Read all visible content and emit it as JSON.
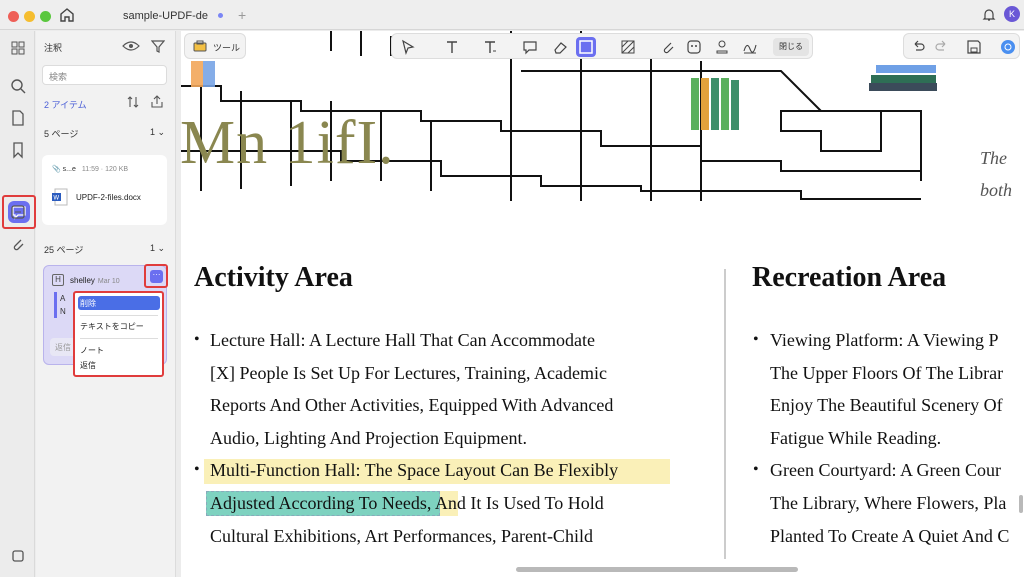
{
  "window": {
    "tab_title": "sample-UPDF-de",
    "avatar_initial": "K"
  },
  "panel": {
    "title": "注釈",
    "search_placeholder": "検索",
    "item_count": "2 アイテム",
    "groups": [
      {
        "page_label": "5 ページ",
        "count": "1",
        "file_name_short": "s...e",
        "file_meta": "11:59 · 120 KB",
        "attachment_name": "UPDF-2-files.docx"
      },
      {
        "page_label": "25 ページ",
        "count": "1",
        "author": "shelley",
        "date": "Mar 10",
        "quote_lines": [
          "A",
          "N"
        ],
        "reply_label": "返信"
      }
    ]
  },
  "context_menu": {
    "items": [
      "削除",
      "テキストをコピー",
      "ノート",
      "返信"
    ]
  },
  "toolbar": {
    "tools_label": "ツール",
    "close_label": "閉じる"
  },
  "document": {
    "big_title": "Mn  1ifI.",
    "italic_lines": [
      "The",
      "both"
    ],
    "left_heading": "Activity Area",
    "right_heading": "Recreation Area",
    "left_lines": [
      "Lecture Hall: A Lecture Hall That Can Accommodate",
      "[X] People Is Set Up For Lectures, Training, Academic",
      "Reports And Other Activities, Equipped With Advanced",
      "Audio, Lighting And Projection Equipment.",
      "Multi-Function Hall: The Space Layout Can Be Flexibly",
      "Adjusted According To Needs, And It Is Used To Hold",
      "Cultural Exhibitions, Art Performances, Parent-Child"
    ],
    "right_lines": [
      "Viewing Platform: A Viewing P",
      "The Upper Floors Of The Librar",
      "Enjoy The Beautiful Scenery Of",
      "Fatigue While Reading.",
      "Green Courtyard: A Green Cour",
      "The Library, Where Flowers, Pla",
      "Planted To Create A Quiet And C"
    ]
  },
  "colors": {
    "accent": "#6b6ff0",
    "callout_red": "#e03c3c",
    "highlight_yellow": "#faf0b8",
    "highlight_teal": "#7ed2c0",
    "title_olive": "#8a8750"
  }
}
